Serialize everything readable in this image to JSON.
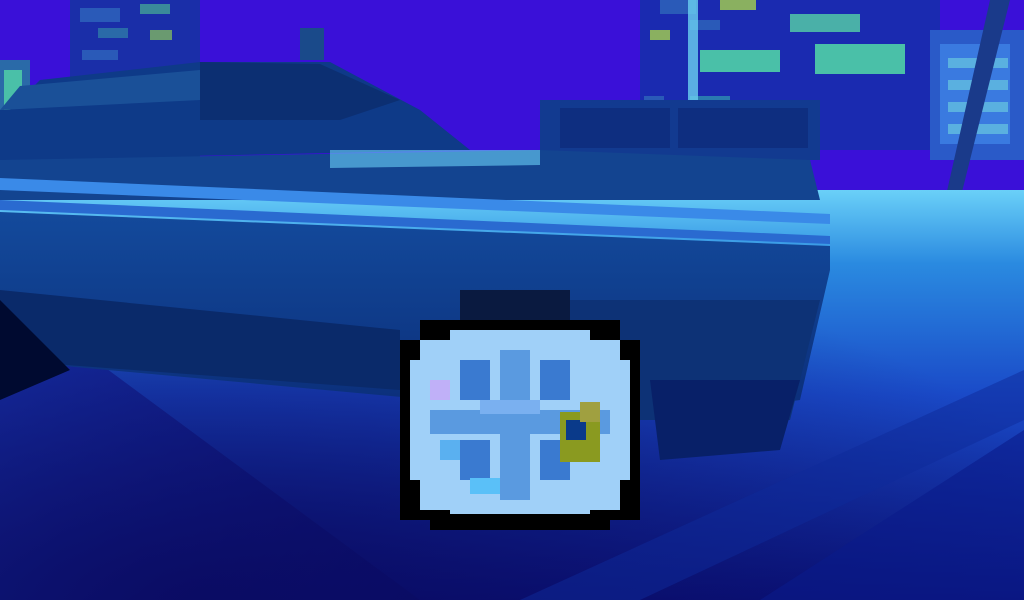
{
  "scene": {
    "name": "voxel-city-night-car",
    "palette": {
      "sky": "#3a10d8",
      "sky_deep": "#2a0ac0",
      "building_blue": "#1a2aa8",
      "building_teal": "#2a6ab0",
      "window_green": "#4ac0a8",
      "window_yellow": "#8ab060",
      "car_body": "#0e3a88",
      "car_body_dark": "#0a2a6a",
      "car_highlight": "#3a8ae8",
      "ground_near": "#0a1a7a",
      "ground_far": "#1a5ad0",
      "ground_glow": "#6ad0f8",
      "wheel_rim": "#a0d0f8",
      "wheel_spoke": "#3a7ad0",
      "wheel_tire": "#000000",
      "wheel_accent": "#8a9a20"
    }
  }
}
